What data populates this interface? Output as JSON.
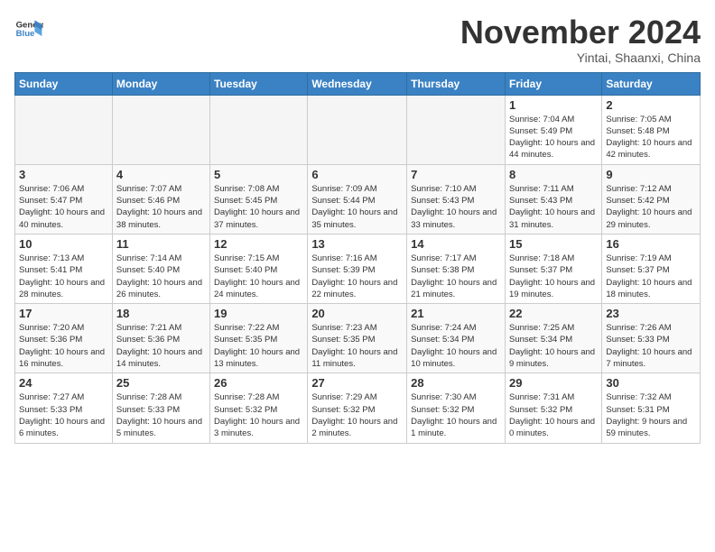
{
  "header": {
    "logo_line1": "General",
    "logo_line2": "Blue",
    "month": "November 2024",
    "location": "Yintai, Shaanxi, China"
  },
  "days_of_week": [
    "Sunday",
    "Monday",
    "Tuesday",
    "Wednesday",
    "Thursday",
    "Friday",
    "Saturday"
  ],
  "weeks": [
    [
      {
        "day": "",
        "info": ""
      },
      {
        "day": "",
        "info": ""
      },
      {
        "day": "",
        "info": ""
      },
      {
        "day": "",
        "info": ""
      },
      {
        "day": "",
        "info": ""
      },
      {
        "day": "1",
        "info": "Sunrise: 7:04 AM\nSunset: 5:49 PM\nDaylight: 10 hours and 44 minutes."
      },
      {
        "day": "2",
        "info": "Sunrise: 7:05 AM\nSunset: 5:48 PM\nDaylight: 10 hours and 42 minutes."
      }
    ],
    [
      {
        "day": "3",
        "info": "Sunrise: 7:06 AM\nSunset: 5:47 PM\nDaylight: 10 hours and 40 minutes."
      },
      {
        "day": "4",
        "info": "Sunrise: 7:07 AM\nSunset: 5:46 PM\nDaylight: 10 hours and 38 minutes."
      },
      {
        "day": "5",
        "info": "Sunrise: 7:08 AM\nSunset: 5:45 PM\nDaylight: 10 hours and 37 minutes."
      },
      {
        "day": "6",
        "info": "Sunrise: 7:09 AM\nSunset: 5:44 PM\nDaylight: 10 hours and 35 minutes."
      },
      {
        "day": "7",
        "info": "Sunrise: 7:10 AM\nSunset: 5:43 PM\nDaylight: 10 hours and 33 minutes."
      },
      {
        "day": "8",
        "info": "Sunrise: 7:11 AM\nSunset: 5:43 PM\nDaylight: 10 hours and 31 minutes."
      },
      {
        "day": "9",
        "info": "Sunrise: 7:12 AM\nSunset: 5:42 PM\nDaylight: 10 hours and 29 minutes."
      }
    ],
    [
      {
        "day": "10",
        "info": "Sunrise: 7:13 AM\nSunset: 5:41 PM\nDaylight: 10 hours and 28 minutes."
      },
      {
        "day": "11",
        "info": "Sunrise: 7:14 AM\nSunset: 5:40 PM\nDaylight: 10 hours and 26 minutes."
      },
      {
        "day": "12",
        "info": "Sunrise: 7:15 AM\nSunset: 5:40 PM\nDaylight: 10 hours and 24 minutes."
      },
      {
        "day": "13",
        "info": "Sunrise: 7:16 AM\nSunset: 5:39 PM\nDaylight: 10 hours and 22 minutes."
      },
      {
        "day": "14",
        "info": "Sunrise: 7:17 AM\nSunset: 5:38 PM\nDaylight: 10 hours and 21 minutes."
      },
      {
        "day": "15",
        "info": "Sunrise: 7:18 AM\nSunset: 5:37 PM\nDaylight: 10 hours and 19 minutes."
      },
      {
        "day": "16",
        "info": "Sunrise: 7:19 AM\nSunset: 5:37 PM\nDaylight: 10 hours and 18 minutes."
      }
    ],
    [
      {
        "day": "17",
        "info": "Sunrise: 7:20 AM\nSunset: 5:36 PM\nDaylight: 10 hours and 16 minutes."
      },
      {
        "day": "18",
        "info": "Sunrise: 7:21 AM\nSunset: 5:36 PM\nDaylight: 10 hours and 14 minutes."
      },
      {
        "day": "19",
        "info": "Sunrise: 7:22 AM\nSunset: 5:35 PM\nDaylight: 10 hours and 13 minutes."
      },
      {
        "day": "20",
        "info": "Sunrise: 7:23 AM\nSunset: 5:35 PM\nDaylight: 10 hours and 11 minutes."
      },
      {
        "day": "21",
        "info": "Sunrise: 7:24 AM\nSunset: 5:34 PM\nDaylight: 10 hours and 10 minutes."
      },
      {
        "day": "22",
        "info": "Sunrise: 7:25 AM\nSunset: 5:34 PM\nDaylight: 10 hours and 9 minutes."
      },
      {
        "day": "23",
        "info": "Sunrise: 7:26 AM\nSunset: 5:33 PM\nDaylight: 10 hours and 7 minutes."
      }
    ],
    [
      {
        "day": "24",
        "info": "Sunrise: 7:27 AM\nSunset: 5:33 PM\nDaylight: 10 hours and 6 minutes."
      },
      {
        "day": "25",
        "info": "Sunrise: 7:28 AM\nSunset: 5:33 PM\nDaylight: 10 hours and 5 minutes."
      },
      {
        "day": "26",
        "info": "Sunrise: 7:28 AM\nSunset: 5:32 PM\nDaylight: 10 hours and 3 minutes."
      },
      {
        "day": "27",
        "info": "Sunrise: 7:29 AM\nSunset: 5:32 PM\nDaylight: 10 hours and 2 minutes."
      },
      {
        "day": "28",
        "info": "Sunrise: 7:30 AM\nSunset: 5:32 PM\nDaylight: 10 hours and 1 minute."
      },
      {
        "day": "29",
        "info": "Sunrise: 7:31 AM\nSunset: 5:32 PM\nDaylight: 10 hours and 0 minutes."
      },
      {
        "day": "30",
        "info": "Sunrise: 7:32 AM\nSunset: 5:31 PM\nDaylight: 9 hours and 59 minutes."
      }
    ]
  ]
}
